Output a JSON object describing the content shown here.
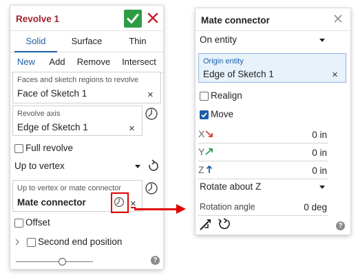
{
  "revolve": {
    "title": "Revolve 1",
    "tabs_type": [
      "Solid",
      "Surface",
      "Thin"
    ],
    "tabs_op": [
      "New",
      "Add",
      "Remove",
      "Intersect"
    ],
    "faces_field": {
      "label": "Faces and sketch regions to revolve",
      "value": "Face of Sketch 1"
    },
    "axis_field": {
      "label": "Revolve axis",
      "value": "Edge of Sketch 1"
    },
    "full_revolve_label": "Full revolve",
    "end_type": "Up to vertex",
    "vertex_field": {
      "label": "Up to vertex or mate connector",
      "value": "Mate connector"
    },
    "offset_label": "Offset",
    "second_end_label": "Second end position",
    "slider_fraction": 0.6,
    "help": "?"
  },
  "mate_connector": {
    "title": "Mate connector",
    "placement": "On entity",
    "origin_field": {
      "label": "Origin entity",
      "value": "Edge of Sketch 1"
    },
    "realign_label": "Realign",
    "realign_checked": false,
    "move_label": "Move",
    "move_checked": true,
    "offsets": [
      {
        "axis": "X",
        "value": "0 in",
        "color": "#d33a2c"
      },
      {
        "axis": "Y",
        "value": "0 in",
        "color": "#2e9c45"
      },
      {
        "axis": "Z",
        "value": "0 in",
        "color": "#1b5ea8"
      }
    ],
    "rotation_type": "Rotate about Z",
    "rotation_angle_label": "Rotation angle",
    "rotation_angle_value": "0 deg",
    "help": "?"
  },
  "colors": {
    "accent_blue": "#1b5ea8",
    "title_red": "#a3202d",
    "ok_green": "#2e9c45",
    "highlight_red": "#e00000"
  }
}
